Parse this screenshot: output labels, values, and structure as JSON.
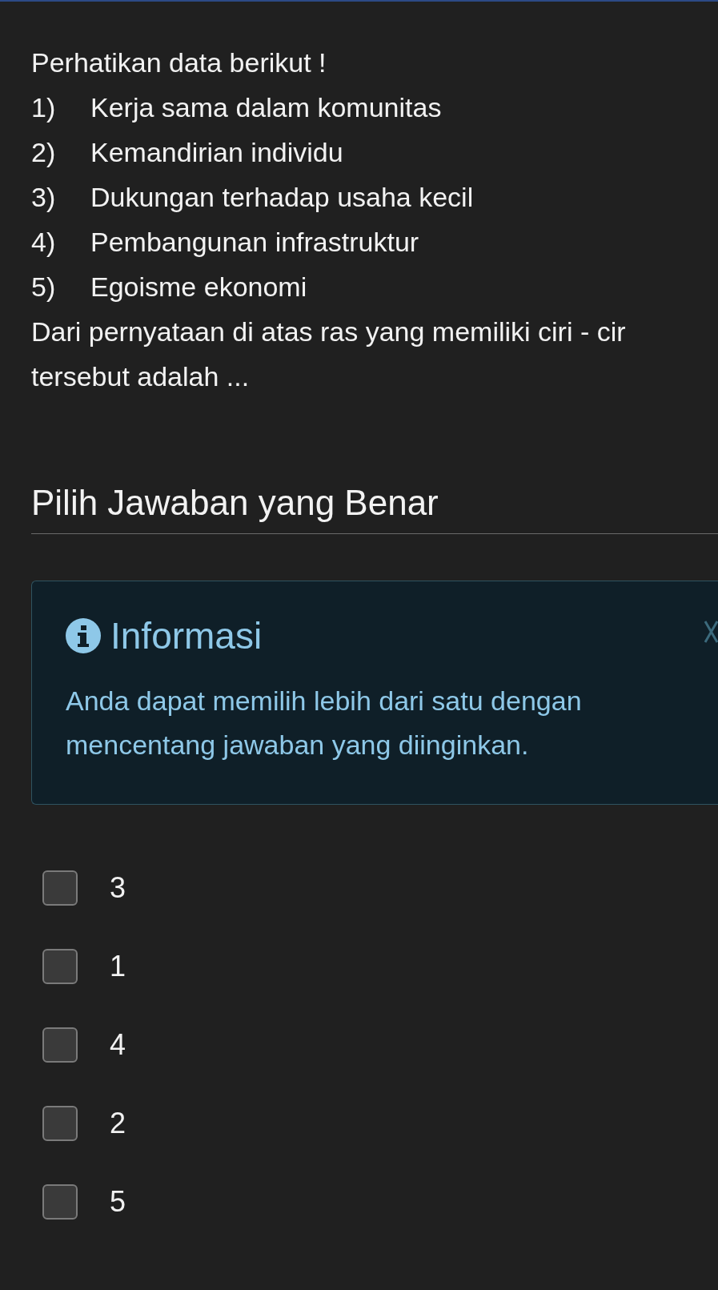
{
  "question": {
    "intro": "Perhatikan data berikut !",
    "items": [
      {
        "number": "1)",
        "text": "Kerja sama dalam komunitas"
      },
      {
        "number": "2)",
        "text": "Kemandirian individu"
      },
      {
        "number": "3)",
        "text": "Dukungan terhadap usaha kecil"
      },
      {
        "number": "4)",
        "text": "Pembangunan infrastruktur"
      },
      {
        "number": "5)",
        "text": "Egoisme ekonomi"
      }
    ],
    "prompt_lines": [
      "Dari pernyataan di atas ras yang memiliki ciri - cir",
      "tersebut adalah ..."
    ]
  },
  "answer_heading": "Pilih Jawaban yang Benar",
  "info": {
    "title": "Informasi",
    "message": "Anda dapat memilih lebih dari satu dengan mencentang jawaban yang diinginkan."
  },
  "options": [
    {
      "label": "3",
      "checked": false
    },
    {
      "label": "1",
      "checked": false
    },
    {
      "label": "4",
      "checked": false
    },
    {
      "label": "2",
      "checked": false
    },
    {
      "label": "5",
      "checked": false
    }
  ]
}
